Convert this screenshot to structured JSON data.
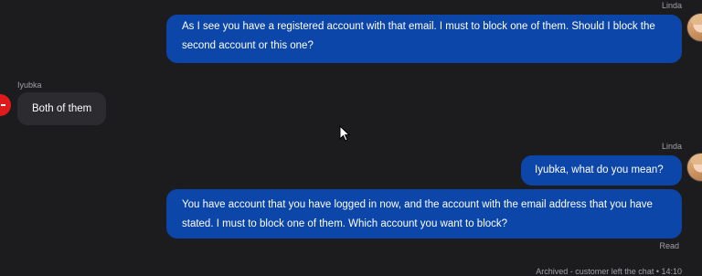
{
  "messages": [
    {
      "author": "Linda",
      "text": "As I see you have a registered account with that email. I must to block one of them. Should I block the second account or this one?"
    },
    {
      "author": "Iyubka",
      "text": "Both of them"
    },
    {
      "author": "Linda",
      "text": "Iyubka, what do you mean?"
    },
    {
      "text": "You have account that you have logged in now, and the account with the email address that you have stated. I must to block one of them. Which account you want to block?"
    }
  ],
  "read_status": "Read",
  "archived_note": "Archived - customer left the chat • 14:10",
  "colors": {
    "background": "#1c1c1e",
    "agent_bubble": "#0b46a8",
    "customer_bubble": "#2c2c30",
    "customer_avatar": "#e01a1a"
  },
  "icons": {
    "agent_avatar": "agent-avatar",
    "customer_avatar": "customer-avatar",
    "cursor": "mouse-pointer"
  }
}
